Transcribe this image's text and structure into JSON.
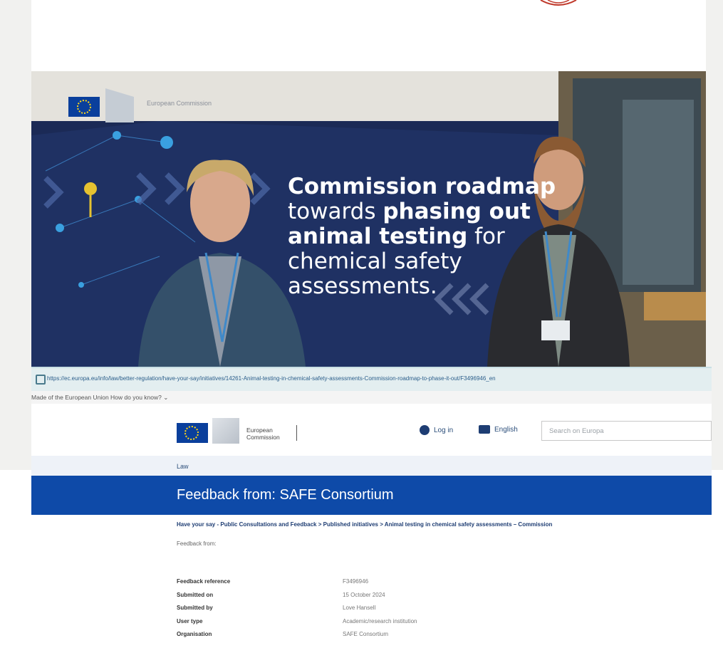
{
  "banner": {
    "org": "European Commission",
    "line1": "Commission roadmap",
    "line2_a": "towards ",
    "line2_b": "phasing out",
    "line3_a": "animal testing",
    "line3_b": " for",
    "line4": "chemical safety",
    "line5": "assessments."
  },
  "browser": {
    "url": "https://ec.europa.eu/info/law/better-regulation/have-your-say/initiatives/14261-Animal-testing-in-chemical-safety-assessments-Commission-roadmap-to-phase-it-out/F3496946_en"
  },
  "eu_strip": {
    "text": "Made of the European Union   How do you know? ⌄"
  },
  "header": {
    "org_line1": "European",
    "org_line2": "Commission",
    "login": "Log in",
    "language": "English",
    "search_placeholder": "Search on Europa"
  },
  "law_label": "Law",
  "page_title": "Feedback from: SAFE Consortium",
  "breadcrumb": "Have your say - Public Consultations and Feedback  >  Published initiatives  >  Animal testing in chemical safety assessments – Commission",
  "subheading": "Feedback from:",
  "details": [
    {
      "key": "Feedback reference",
      "value": "F3496946"
    },
    {
      "key": "Submitted on",
      "value": "15 October 2024"
    },
    {
      "key": "Submitted by",
      "value": "Love Hansell"
    },
    {
      "key": "User type",
      "value": "Academic/research institution"
    },
    {
      "key": "Organisation",
      "value": "SAFE Consortium"
    }
  ],
  "colors": {
    "eu_blue": "#0e4aa8",
    "banner_navy": "#1b2a56",
    "link_blue": "#1e3d73"
  }
}
